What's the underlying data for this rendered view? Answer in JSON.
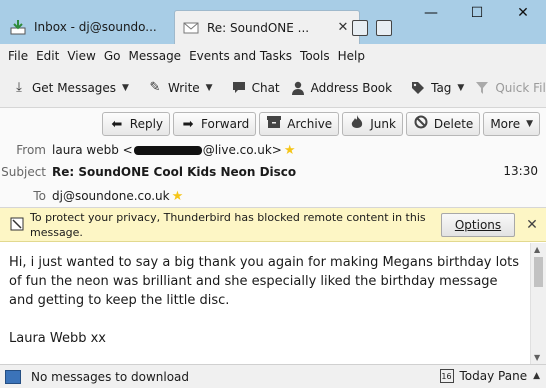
{
  "tabs": [
    {
      "label": "Inbox - dj@soundo...",
      "icon": "inbox-download-icon"
    },
    {
      "label": "Re: SoundONE ...",
      "icon": "envelope-icon",
      "close": "✕"
    }
  ],
  "window_controls": {
    "minimize": "—",
    "maximize": "☐",
    "close": "✕"
  },
  "menu": [
    "File",
    "Edit",
    "View",
    "Go",
    "Message",
    "Events and Tasks",
    "Tools",
    "Help"
  ],
  "toolbar": {
    "get_messages": "Get Messages",
    "write": "Write",
    "chat": "Chat",
    "address_book": "Address Book",
    "tag": "Tag",
    "quick_filter": "Quick Filter"
  },
  "actions": {
    "reply": "Reply",
    "forward": "Forward",
    "archive": "Archive",
    "junk": "Junk",
    "delete": "Delete",
    "more": "More"
  },
  "header": {
    "from_label": "From",
    "from_name": "laura webb <",
    "from_domain": "@live.co.uk>",
    "subject_label": "Subject",
    "subject": "Re: SoundONE Cool Kids Neon Disco",
    "to_label": "To",
    "to": "dj@soundone.co.uk",
    "time": "13:30"
  },
  "notification": {
    "text": "To protect your privacy, Thunderbird has blocked remote content in this message.",
    "options": "Options"
  },
  "message_body": {
    "para1": "Hi, i just wanted to say a big thank you again for making Megans birthday lots of fun the neon was brilliant and she especially liked the birthday message and getting to keep the little disc.",
    "para2": "Laura Webb xx"
  },
  "statusbar": {
    "text": "No messages to download",
    "today_pane": "Today Pane",
    "calendar_day": "16"
  },
  "colors": {
    "titlebar": "#a8cde6",
    "notification": "#fdf6c5",
    "star": "#f5c518"
  }
}
